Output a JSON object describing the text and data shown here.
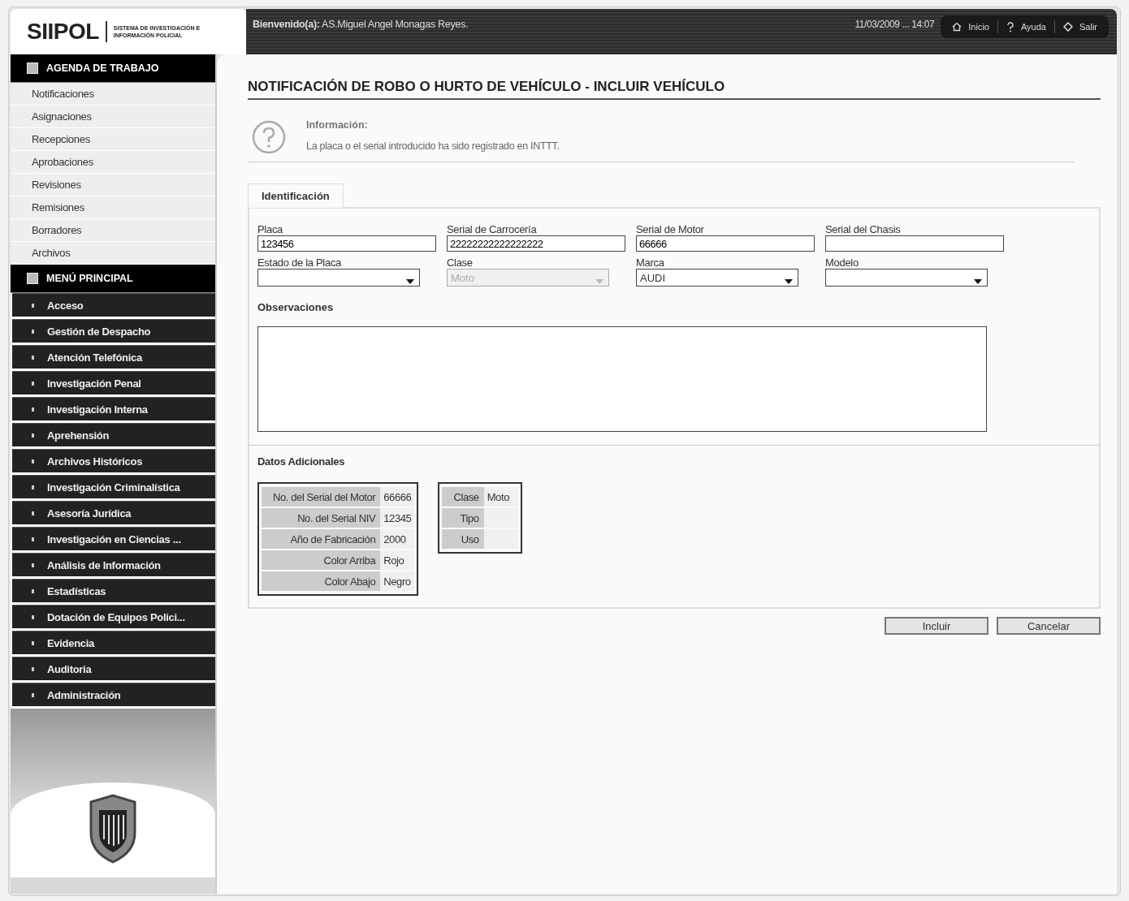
{
  "logo": {
    "title": "SIIPOL",
    "subtitle": "SISTEMA DE INVESTIGACIÓN E INFORMACIÓN POLICIAL"
  },
  "header": {
    "welcome_label": "Bienvenido(a):",
    "user": "AS.Miguel Angel Monagas Reyes.",
    "datetime": "11/03/2009 ... 14:07",
    "links": [
      {
        "kind": "home",
        "label": "Inicio"
      },
      {
        "kind": "help",
        "label": "Ayuda"
      },
      {
        "kind": "exit",
        "label": "Salir"
      }
    ]
  },
  "sidebar": {
    "agenda_title": "AGENDA DE TRABAJO",
    "agenda_items": [
      "Notificaciones",
      "Asignaciones",
      "Recepciones",
      "Aprobaciones",
      "Revisiones",
      "Remisiones",
      "Borradores",
      "Archivos"
    ],
    "menu_title": "MENÚ PRINCIPAL",
    "menu_items": [
      "Acceso",
      "Gestión de Despacho",
      "Atención Telefónica",
      "Investigación Penal",
      "Investigación Interna",
      "Aprehensión",
      "Archivos Históricos",
      "Investigación Criminalística",
      "Asesoría Jurídica",
      "Investigación en Ciencias ...",
      "Análisis de Información",
      "Estadísticas",
      "Dotación de Equipos Polici...",
      "Evidencia",
      "Auditoria",
      "Administración"
    ]
  },
  "page_title": "NOTIFICACIÓN DE ROBO O HURTO DE VEHÍCULO - INCLUIR VEHÍCULO",
  "info": {
    "title": "Información:",
    "message": "La placa o el serial introducido ha sido registrado en INTTT."
  },
  "tabs": [
    {
      "label": "Identificación",
      "selected": true
    }
  ],
  "fields": [
    {
      "kind": "text",
      "label": "Placa",
      "value": "123456",
      "disabled": false
    },
    {
      "kind": "text",
      "label": "Serial de Carrocería",
      "value": "22222222222222222",
      "disabled": false
    },
    {
      "kind": "text",
      "label": "Serial de Motor",
      "value": "66666",
      "disabled": false
    },
    {
      "kind": "text",
      "label": "Serial del Chasis",
      "disabled": false
    },
    {
      "kind": "select",
      "label": "Estado de la Placa",
      "disabled": false
    },
    {
      "kind": "select",
      "label": "Clase",
      "value": "Moto",
      "disabled": true
    },
    {
      "kind": "select",
      "label": "Marca",
      "value": "AUDI",
      "disabled": false
    },
    {
      "kind": "select",
      "label": "Modelo",
      "disabled": false
    }
  ],
  "observations_label": "Observaciones",
  "additional_label": "Datos Adicionales",
  "additional_tables": [
    {
      "rows": [
        {
          "label": "No. del Serial del Motor",
          "value": "66666"
        },
        {
          "label": "No. del Serial NIV",
          "value": "12345"
        },
        {
          "label": "Año de Fabricación",
          "value": "2000"
        },
        {
          "label": "Color Arriba",
          "value": "Rojo"
        },
        {
          "label": "Color Abajo",
          "value": "Negro"
        }
      ]
    },
    {
      "rows": [
        {
          "label": "Clase",
          "value": "Moto"
        },
        {
          "label": "Tipo"
        },
        {
          "label": "Uso"
        }
      ]
    }
  ],
  "buttons": [
    "Incluir",
    "Cancelar"
  ]
}
